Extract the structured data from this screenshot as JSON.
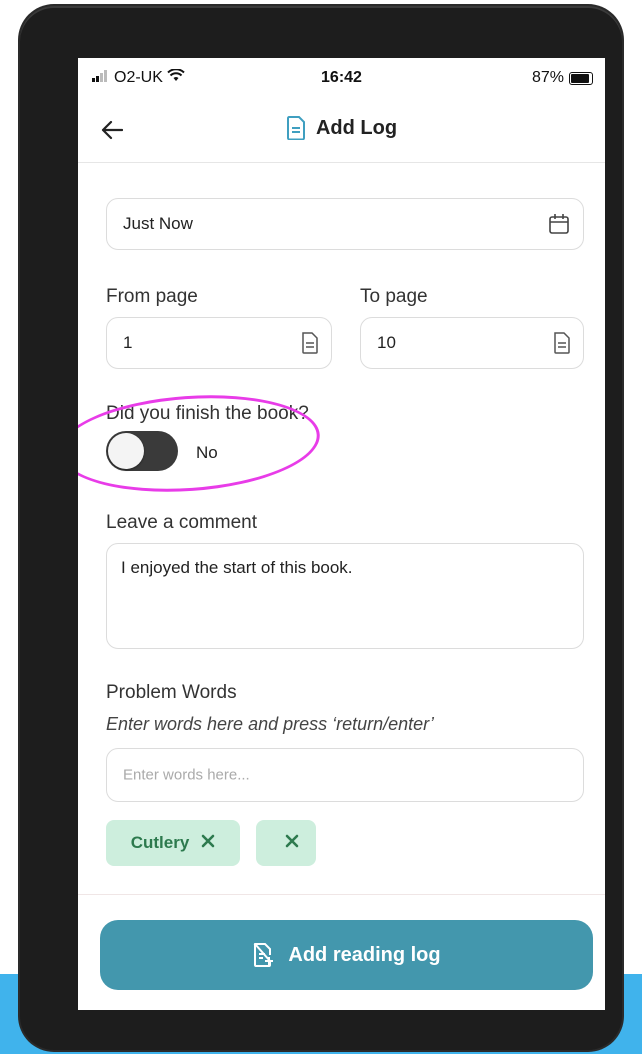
{
  "status_bar": {
    "carrier": "O2-UK",
    "time": "16:42",
    "battery": "87%"
  },
  "header": {
    "title": "Add Log"
  },
  "date_field": {
    "value": "Just Now"
  },
  "pages": {
    "from_label": "From page",
    "from_value": "1",
    "to_label": "To page",
    "to_value": "10"
  },
  "finished": {
    "question": "Did you finish the book?",
    "toggle_label": "No",
    "toggle_on": false
  },
  "comment": {
    "label": "Leave a comment",
    "value": "I enjoyed the start of this book."
  },
  "problem_words": {
    "label": "Problem Words",
    "hint": "Enter words here and press ‘return/enter’",
    "placeholder": "Enter words here...",
    "tags": [
      {
        "label": "Cutlery"
      },
      {
        "label": ""
      }
    ]
  },
  "submit": {
    "label": "Add reading log"
  },
  "colors": {
    "primary_button": "#4397ad",
    "tag_bg": "#cdeedd",
    "tag_text": "#2d7a4e",
    "highlight": "#e83ce8",
    "bezel": "#1d1d1d"
  }
}
